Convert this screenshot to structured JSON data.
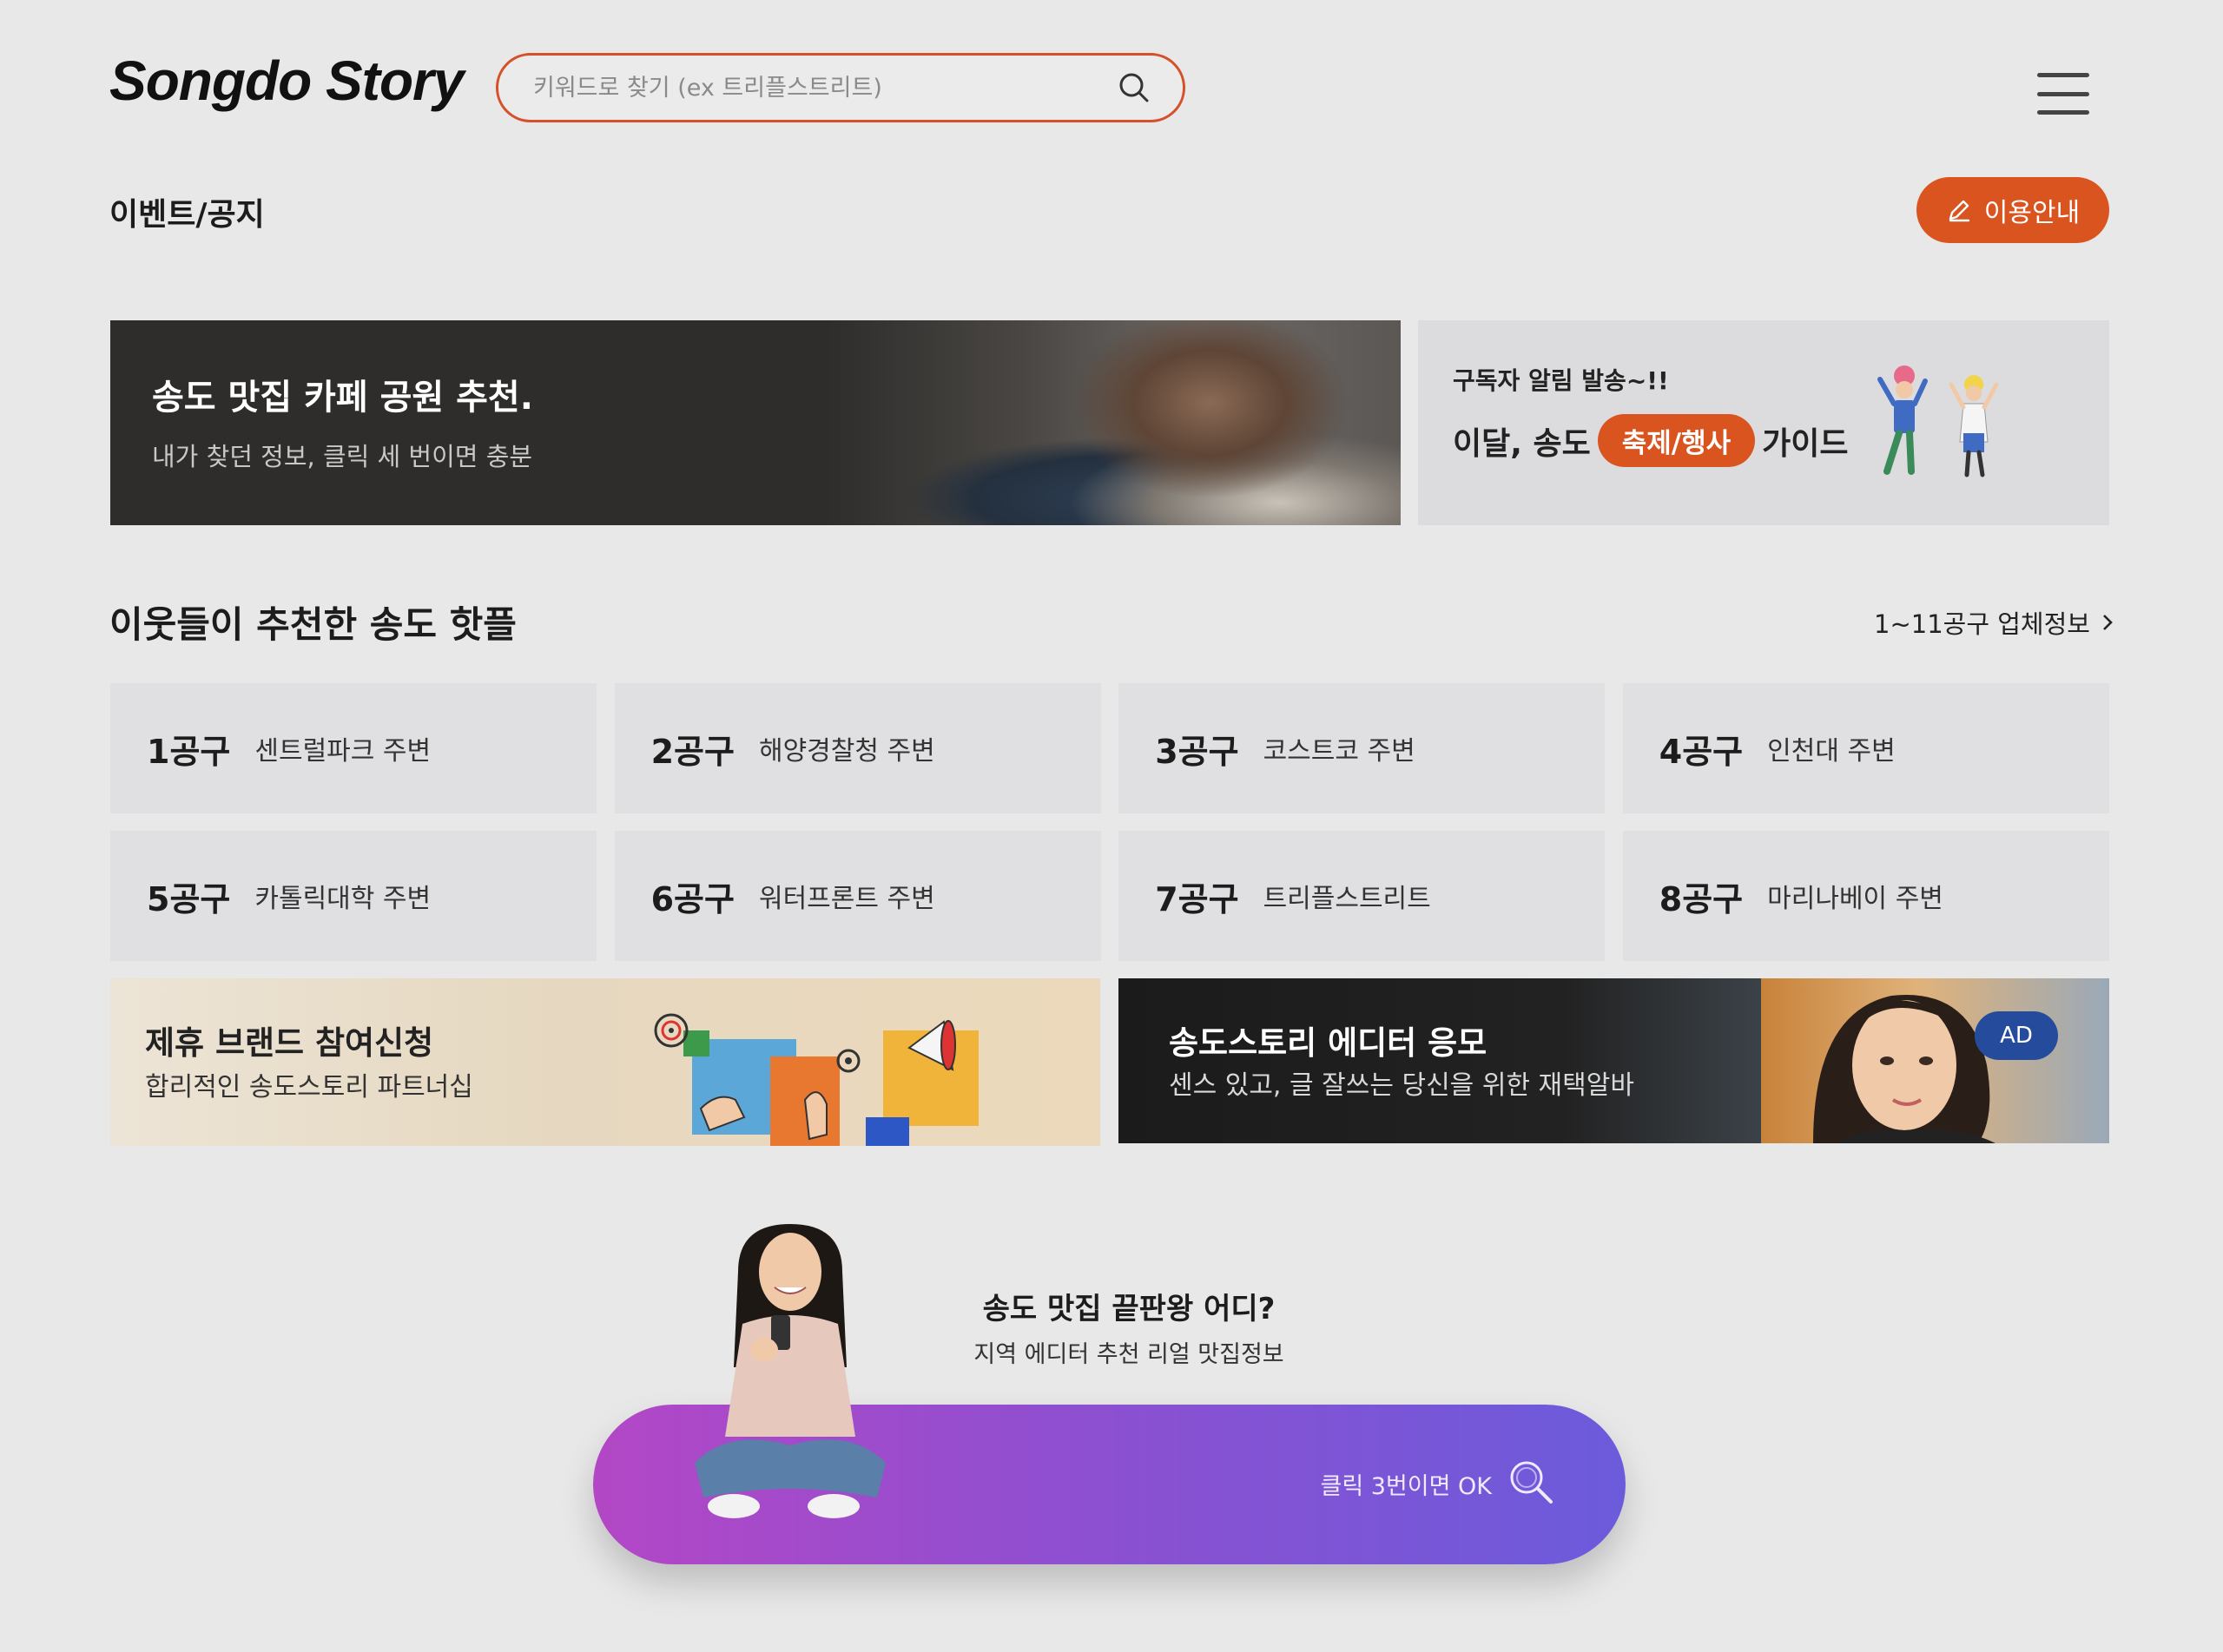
{
  "header": {
    "logo": "Songdo Story",
    "search_placeholder": "키워드로 찾기 (ex 트리플스트리트)",
    "search_icon": "search-icon",
    "menu_icon": "hamburger-menu-icon"
  },
  "events": {
    "heading": "이벤트/공지",
    "guide_button": "이용안내",
    "guide_icon": "pencil-icon"
  },
  "banners": {
    "main": {
      "title": "송도 맛집 카페 공원 추천.",
      "subtitle": "내가 찾던 정보, 클릭 세 번이면 충분"
    },
    "alert": {
      "small": "구독자 알림 발송~!!",
      "prefix": "이달, 송도",
      "pill": "축제/행사",
      "suffix": "가이드"
    }
  },
  "hotplaces": {
    "heading": "이웃들이 추천한 송도 핫플",
    "more_link": "1~11공구 업체정보",
    "items": [
      {
        "num": "1공구",
        "area": "센트럴파크 주변"
      },
      {
        "num": "2공구",
        "area": "해양경찰청 주변"
      },
      {
        "num": "3공구",
        "area": "코스트코 주변"
      },
      {
        "num": "4공구",
        "area": "인천대 주변"
      },
      {
        "num": "5공구",
        "area": "카톨릭대학 주변"
      },
      {
        "num": "6공구",
        "area": "워터프론트 주변"
      },
      {
        "num": "7공구",
        "area": "트리플스트리트"
      },
      {
        "num": "8공구",
        "area": "마리나베이 주변"
      }
    ]
  },
  "partner": {
    "title": "제휴 브랜드 참여신청",
    "subtitle": "합리적인 송도스토리 파트너십"
  },
  "editor": {
    "title": "송도스토리 에디터 응모",
    "subtitle": "센스 있고, 글 잘쓰는 당신을 위한 재택알바",
    "badge": "AD"
  },
  "cta": {
    "title": "송도 맛집 끝판왕 어디?",
    "subtitle": "지역 에디터 추천 리얼 맛집정보",
    "button_label": "클릭 3번이면 OK"
  },
  "colors": {
    "accent": "#d9541f",
    "background": "#e8e8e8",
    "cta_start": "#b347c6",
    "cta_end": "#6b5bdb",
    "ad_badge": "#254c9c"
  }
}
